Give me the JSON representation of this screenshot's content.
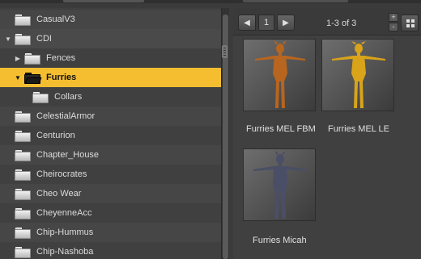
{
  "tree": {
    "items": [
      {
        "label": "CasualV3"
      },
      {
        "label": "CDI"
      },
      {
        "label": "Fences"
      },
      {
        "label": "Furries"
      },
      {
        "label": "Collars"
      },
      {
        "label": "CelestialArmor"
      },
      {
        "label": "Centurion"
      },
      {
        "label": "Chapter_House"
      },
      {
        "label": "Cheirocrates"
      },
      {
        "label": "Cheo Wear"
      },
      {
        "label": "CheyenneAcc"
      },
      {
        "label": "Chip-Hummus"
      },
      {
        "label": "Chip-Nashoba"
      }
    ],
    "selected_color": "#f5be30"
  },
  "toolbar": {
    "prev_icon": "arrow-left-icon",
    "page": "1",
    "next_icon": "arrow-right-icon",
    "page_info": "1-3 of 3",
    "zoom_in": "+",
    "zoom_out": "-",
    "view_icon": "grid-view-icon"
  },
  "content": {
    "items": [
      {
        "caption": "Furries MEL FBM",
        "figure_color": "#b8651f"
      },
      {
        "caption": "Furries MEL LE",
        "figure_color": "#d9a31a"
      },
      {
        "caption": "Furries Micah",
        "figure_color": "#4a4e66"
      }
    ]
  }
}
